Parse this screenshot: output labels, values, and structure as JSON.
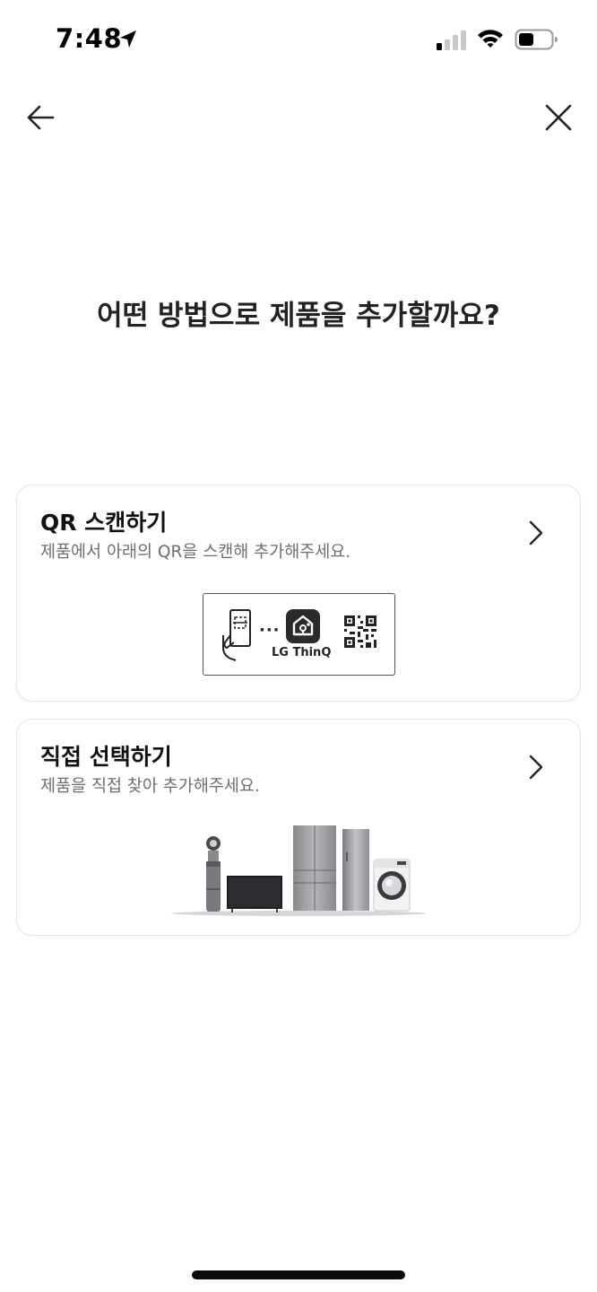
{
  "status_bar": {
    "time": "7:48"
  },
  "nav": {
    "back_icon": "arrow-left-icon",
    "close_icon": "close-icon"
  },
  "title": "어떤 방법으로 제품을 추가할까요?",
  "options": [
    {
      "title": "QR 스캔하기",
      "description": "제품에서 아래의 QR을 스캔해 추가해주세요.",
      "illustration": {
        "dots": "···",
        "logo_text": "LG ThinQ"
      }
    },
    {
      "title": "직접 선택하기",
      "description": "제품을 직접 찾아 추가해주세요."
    }
  ],
  "colors": {
    "text_primary": "#111111",
    "text_secondary": "#6e6e72",
    "card_border": "#e4e4e6"
  }
}
